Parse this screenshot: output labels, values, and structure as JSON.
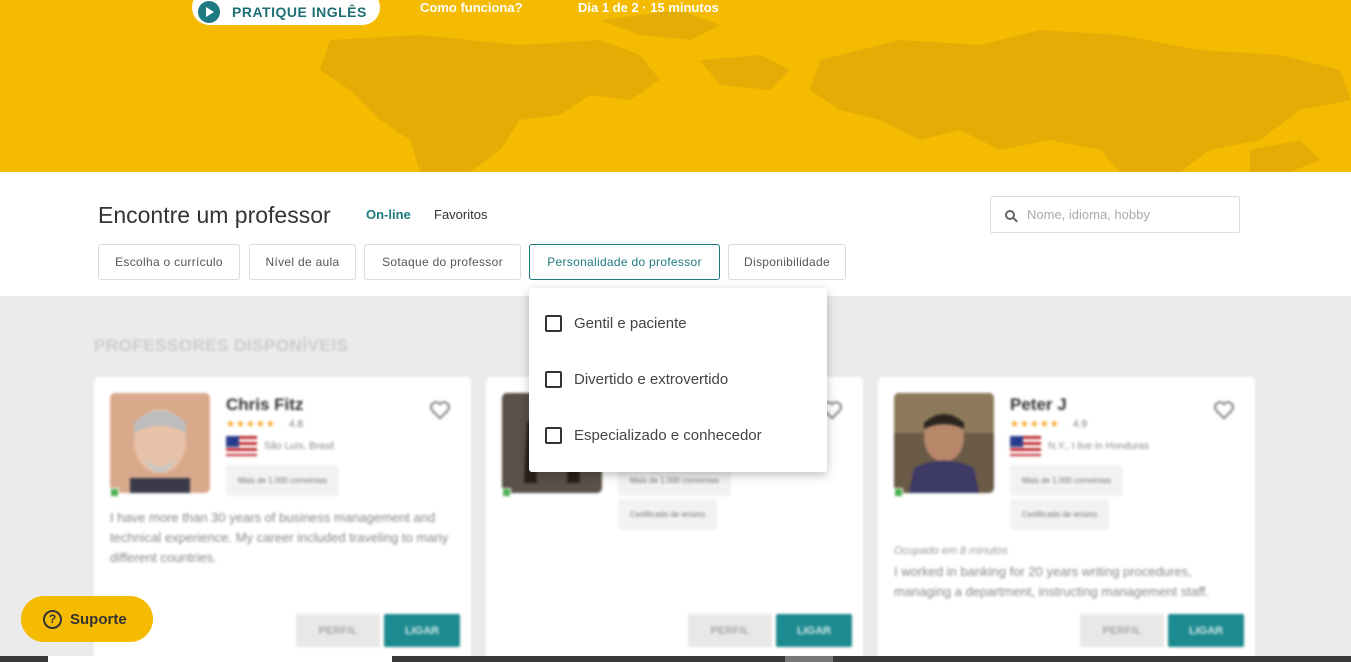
{
  "hero": {
    "practice_label": "PRATIQUE INGLÊS",
    "how_it_works": "Como funciona?",
    "day_info": "Dia 1 de 2 · 15 minutos"
  },
  "finder": {
    "title": "Encontre um professor",
    "tab_online": "On-line",
    "tab_favorites": "Favoritos",
    "search_placeholder": "Nome, idioma, hobby"
  },
  "filters": [
    {
      "label": "Escolha o currículo"
    },
    {
      "label": "Nível de aula"
    },
    {
      "label": "Sotaque do professor"
    },
    {
      "label": "Personalidade do professor"
    },
    {
      "label": "Disponibilidade"
    }
  ],
  "personality_dropdown": {
    "options": [
      {
        "label": "Gentil e paciente",
        "checked": false
      },
      {
        "label": "Divertido e extrovertido",
        "checked": false
      },
      {
        "label": "Especializado e conhecedor",
        "checked": false
      }
    ]
  },
  "section_title": "PROFESSORES DISPONÍVEIS",
  "teachers": [
    {
      "name": "Chris Fitz",
      "stars": "★★★★★",
      "rating": "4.8",
      "location": "São Luís, Brasil",
      "chip1": "Mais de 1.000 conversas",
      "description": "I have more than 30 years of business management and technical experience. My career included traveling to many different countries.",
      "profile_label": "PERFIL",
      "call_label": "LIGAR"
    },
    {
      "chip1": "Mais de 1.000 conversas",
      "chip2": "Certificado de ensino",
      "profile_label": "PERFIL",
      "call_label": "LIGAR"
    },
    {
      "name": "Peter J",
      "stars": "★★★★★",
      "rating": "4.9",
      "location": "N.Y., I live in Honduras",
      "chip1": "Mais de 1.000 conversas",
      "chip2": "Certificado de ensino",
      "note": "Ocupado em 8 minutos",
      "description": "I worked in banking for 20 years writing procedures, managing a department, instructing management staff.",
      "profile_label": "PERFIL",
      "call_label": "LIGAR"
    }
  ],
  "support": {
    "label": "Suporte"
  },
  "colors": {
    "brand_yellow": "#f5bb00",
    "teal": "#1d7a80"
  }
}
